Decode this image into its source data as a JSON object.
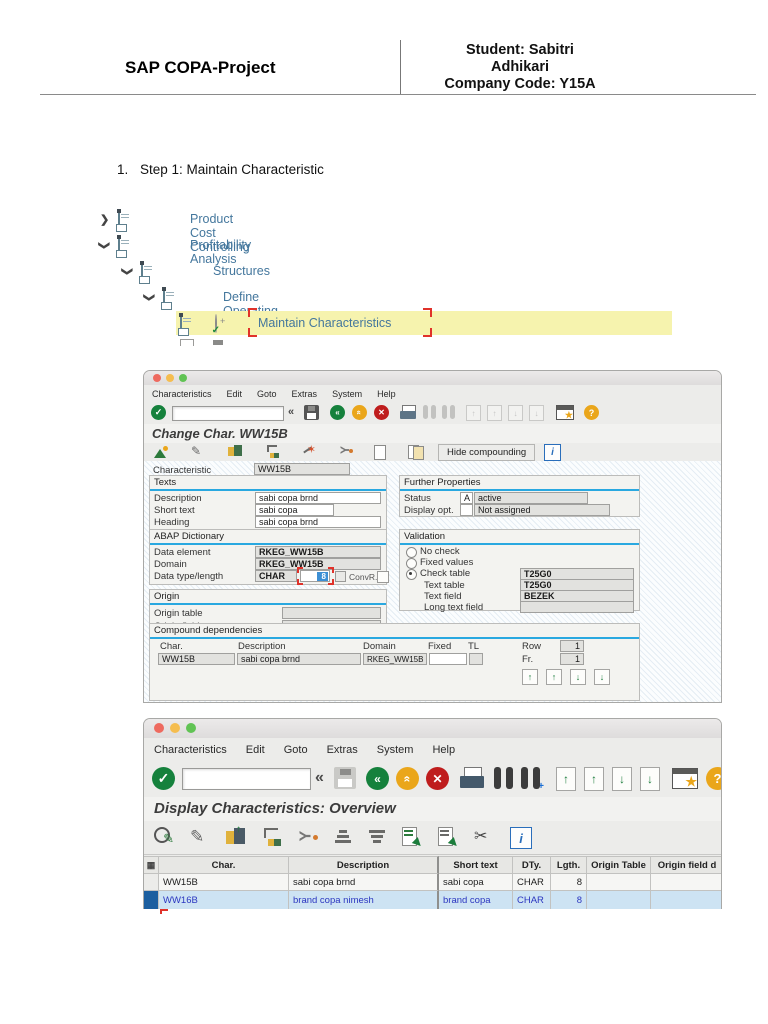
{
  "doc": {
    "header": {
      "title": "SAP COPA-Project",
      "student_line1": "Student: Sabitri",
      "student_line2": "Adhikari",
      "company_line": "Company Code: Y15A"
    },
    "step_marker": "1.",
    "step_heading": "Step 1: Maintain Characteristic"
  },
  "tree": {
    "items": [
      {
        "label": "Product Cost Controlling",
        "expanded": false
      },
      {
        "label": "Profitability Analysis",
        "expanded": true
      },
      {
        "label": "Structures",
        "expanded": true
      },
      {
        "label": "Define Operating Concern",
        "expanded": true
      },
      {
        "label": "Maintain Characteristics",
        "highlighted": true
      }
    ]
  },
  "window1": {
    "menu": [
      "Characteristics",
      "Edit",
      "Goto",
      "Extras",
      "System",
      "Help"
    ],
    "title": "Change Char. WW15B",
    "toolbar": {
      "hide_compounding": "Hide compounding"
    },
    "form": {
      "characteristic_label": "Characteristic",
      "characteristic_value": "WW15B",
      "texts": {
        "legend": "Texts",
        "description_label": "Description",
        "description_value": "sabi copa brnd",
        "short_text_label": "Short text",
        "short_text_value": "sabi copa",
        "heading_label": "Heading",
        "heading_value": "sabi copa brnd"
      },
      "further": {
        "legend": "Further Properties",
        "status_label": "Status",
        "status_code": "A",
        "status_value": "active",
        "display_opt_label": "Display opt.",
        "display_opt_value": "Not assigned"
      },
      "abap": {
        "legend": "ABAP Dictionary",
        "data_element_label": "Data element",
        "data_element_value": "RKEG_WW15B",
        "domain_label": "Domain",
        "domain_value": "RKEG_WW15B",
        "data_type_label": "Data type/length",
        "data_type_value": "CHAR",
        "length_value": "8",
        "convr_label": "ConvR."
      },
      "validation": {
        "legend": "Validation",
        "no_check_label": "No check",
        "fixed_values_label": "Fixed values",
        "check_table_label": "Check table",
        "check_table_value": "T25G0",
        "text_table_label": "Text table",
        "text_table_value": "T25G0",
        "text_field_label": "Text field",
        "text_field_value": "BEZEK",
        "long_text_label": "Long text field"
      },
      "origin": {
        "legend": "Origin",
        "origin_table_label": "Origin table",
        "origin_field_label": "Origin field"
      },
      "compound": {
        "legend": "Compound dependencies",
        "col_char": "Char.",
        "col_description": "Description",
        "col_domain": "Domain",
        "col_fixed": "Fixed",
        "col_tl": "TL",
        "row_label": "Row",
        "row_value": "1",
        "fr_label": "Fr.",
        "fr_value": "1",
        "entry": {
          "char": "WW15B",
          "description": "sabi copa brnd",
          "domain": "RKEG_WW15B"
        }
      }
    }
  },
  "window2": {
    "menu": [
      "Characteristics",
      "Edit",
      "Goto",
      "Extras",
      "System",
      "Help"
    ],
    "title": "Display Characteristics: Overview",
    "table": {
      "headers": [
        "Char.",
        "Description",
        "Short text",
        "DTy.",
        "Lgth.",
        "Origin Table",
        "Origin field d"
      ],
      "rows": [
        {
          "char": "WW15B",
          "description": "sabi copa brnd",
          "short_text": "sabi copa",
          "dty": "CHAR",
          "lgth": "8",
          "origin_table": "",
          "origin_field": "",
          "selected": false
        },
        {
          "char": "WW16B",
          "description": "brand copa nimesh",
          "short_text": "brand copa",
          "dty": "CHAR",
          "lgth": "8",
          "origin_table": "",
          "origin_field": "",
          "selected": true
        }
      ]
    }
  },
  "icons": {
    "enter_check": "✓",
    "collapse_chevrons": "«",
    "back_arrow": "«",
    "exit_up": "«",
    "cancel_x": "✕",
    "help_question": "?",
    "info_i": "i",
    "new_session_star": "★",
    "cut_scissors": "✂",
    "tree_chevron": "❯",
    "nav_up": "↑",
    "nav_down": "↓",
    "find_plus": "+",
    "table_select_grid": "▦",
    "wand_sparkle": "✶",
    "pencil": "✎",
    "split_y": "Y"
  },
  "colors": {
    "accent_blue": "#29a8e0",
    "tree_text": "#44779d",
    "highlight_yellow": "#f6f3ae",
    "selected_row_bg": "#cde3f3",
    "selected_row_text": "#2b36c0",
    "sap_green": "#15813c",
    "sap_orange": "#eaa61b",
    "sap_red": "#bf1d1d"
  }
}
